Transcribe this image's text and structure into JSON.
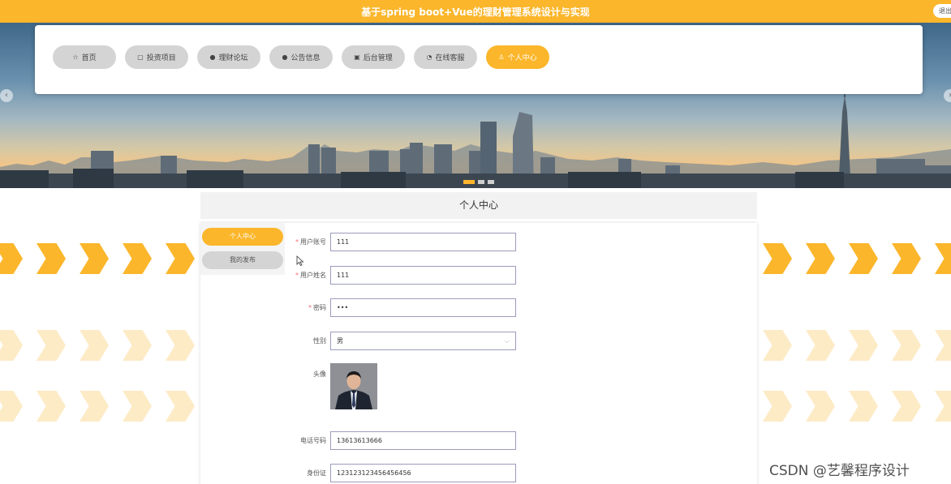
{
  "header": {
    "title": "基于spring boot+Vue的理财管理系统设计与实现",
    "logout_label": "退出"
  },
  "nav": {
    "items": [
      {
        "label": "首页",
        "icon": "☆"
      },
      {
        "label": "投资项目",
        "icon": "▢"
      },
      {
        "label": "理财论坛",
        "icon": "●"
      },
      {
        "label": "公告信息",
        "icon": "●"
      },
      {
        "label": "后台管理",
        "icon": "▣"
      },
      {
        "label": "在线客服",
        "icon": "◔"
      },
      {
        "label": "个人中心",
        "icon": "♙"
      }
    ],
    "active_index": 6
  },
  "banner": {
    "prev_icon": "‹",
    "next_icon": "›",
    "slide_count": 3,
    "active_slide": 0
  },
  "page": {
    "title": "个人中心"
  },
  "side_menu": {
    "items": [
      "个人中心",
      "我的发布"
    ]
  },
  "form": {
    "account_label": "用户账号",
    "account_value": "111",
    "name_label": "用户姓名",
    "name_value": "111",
    "password_label": "密码",
    "password_value": "•••",
    "gender_label": "性别",
    "gender_value": "男",
    "gender_arrow_icon": "⌵",
    "avatar_label": "头像",
    "phone_label": "电话号码",
    "phone_value": "13613613666",
    "id_label": "身份证",
    "id_value": "123123123456456456"
  },
  "watermark": "CSDN @艺馨程序设计",
  "colors": {
    "accent": "#fbb62b",
    "inactive": "#d4d4d4",
    "required": "#f56c6c"
  }
}
